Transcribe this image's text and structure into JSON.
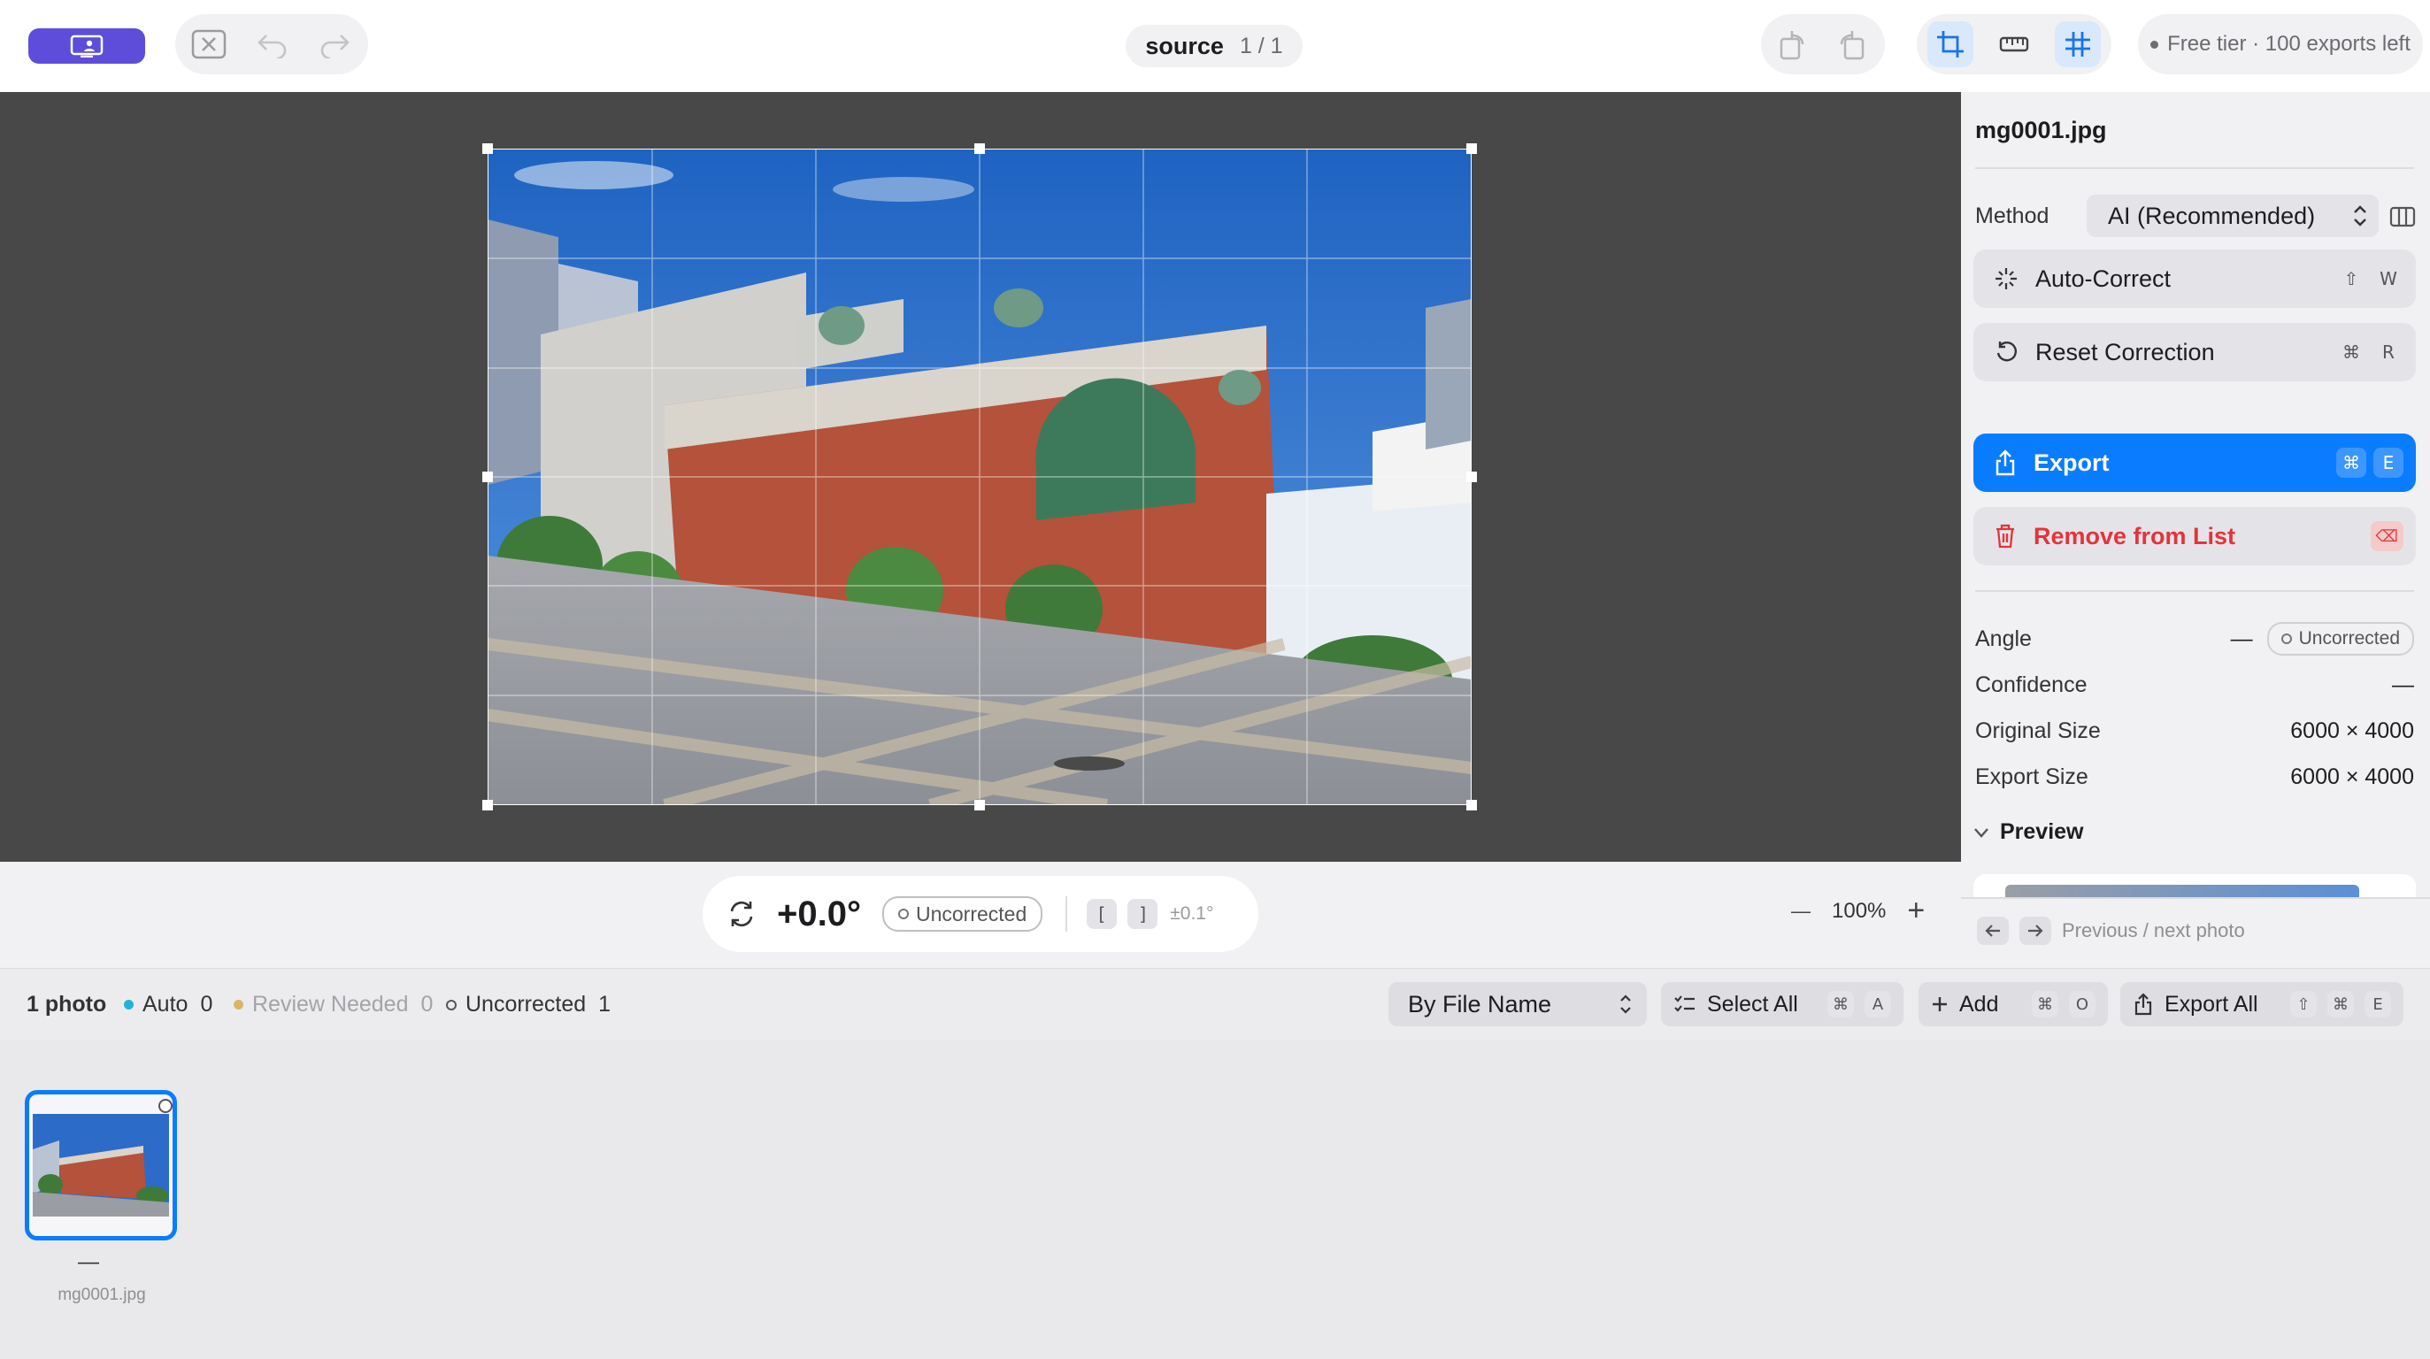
{
  "toolbar": {
    "source_label": "source",
    "page_counter": "1 / 1",
    "tier_text": "Free tier · 100 exports left"
  },
  "icons": {
    "app": "display-person-icon",
    "close": "close-box-icon",
    "undo": "undo-icon",
    "redo": "redo-icon",
    "rotate_left": "rotate-left-icon",
    "rotate_right": "rotate-right-icon",
    "crop": "crop-icon",
    "ruler": "ruler-icon",
    "grid": "grid-icon"
  },
  "panel": {
    "filename": "mg0001.jpg",
    "method_label": "Method",
    "method_value": "AI (Recommended)",
    "auto_correct": {
      "label": "Auto-Correct",
      "keys": [
        "⇧",
        "W"
      ]
    },
    "reset_correction": {
      "label": "Reset Correction",
      "keys": [
        "⌘",
        "R"
      ]
    },
    "export": {
      "label": "Export",
      "keys": [
        "⌘",
        "E"
      ]
    },
    "remove": {
      "label": "Remove from List",
      "key": "⌫"
    },
    "info": {
      "angle_label": "Angle",
      "angle_value": "—",
      "angle_status": "Uncorrected",
      "confidence_label": "Confidence",
      "confidence_value": "—",
      "original_label": "Original Size",
      "original_value": "6000 × 4000",
      "export_label": "Export Size",
      "export_value": "6000 × 4000"
    },
    "preview_label": "Preview",
    "nav_hint": "Previous / next photo"
  },
  "adjust": {
    "angle": "+0.0°",
    "status": "Uncorrected",
    "step_left": "[",
    "step_right": "]",
    "step_hint": "±0.1°",
    "zoom_minus": "—",
    "zoom": "100%",
    "zoom_plus": "+"
  },
  "filmbar": {
    "count": "1 photo",
    "auto_label": "Auto",
    "auto_count": "0",
    "review_label": "Review Needed",
    "review_count": "0",
    "uncorrected_label": "Uncorrected",
    "uncorrected_count": "1",
    "sort": "By File Name",
    "select_all": {
      "label": "Select All",
      "keys": [
        "⌘",
        "A"
      ]
    },
    "add": {
      "label": "Add",
      "keys": [
        "⌘",
        "O"
      ]
    },
    "export_all": {
      "label": "Export All",
      "keys": [
        "⇧",
        "⌘",
        "E"
      ]
    }
  },
  "thumbnails": [
    {
      "name": "mg0001.jpg",
      "angle": "—"
    }
  ],
  "colors": {
    "accent": "#0a7cff",
    "app_button": "#5e4ddb",
    "danger": "#e5333a",
    "auto_dot": "#1fb4d6",
    "review_dot": "#d9b46a",
    "canvas": "#484848"
  }
}
